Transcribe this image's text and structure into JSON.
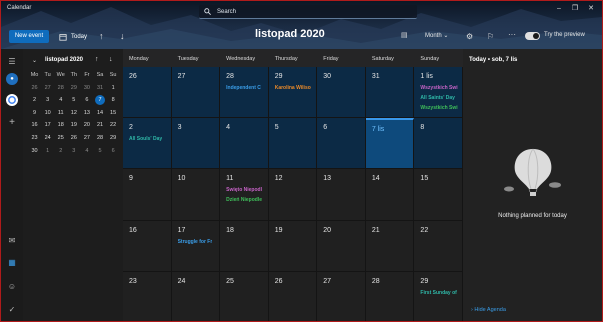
{
  "app": {
    "title": "Calendar"
  },
  "search": {
    "placeholder": "Search"
  },
  "toolbar": {
    "new_event": "New event",
    "today": "Today",
    "month_title": "listopad 2020",
    "view": "Month",
    "try_preview": "Try the preview",
    "icons": [
      "calendar-icon",
      "arrow-up-icon",
      "arrow-down-icon",
      "chevron-down-icon",
      "settings-icon",
      "feedback-icon",
      "more-icon"
    ]
  },
  "rail": {
    "icons": [
      "menu-icon",
      "outlook-account-icon",
      "google-account-icon",
      "add-icon",
      "mail-icon",
      "calendar-icon",
      "people-icon",
      "todo-icon"
    ]
  },
  "mini_calendar": {
    "title": "listopad 2020",
    "weekdays": [
      "Mo",
      "Tu",
      "We",
      "Th",
      "Fr",
      "Sa",
      "Su"
    ],
    "weeks": [
      [
        "26",
        "27",
        "28",
        "29",
        "30",
        "31",
        "1"
      ],
      [
        "2",
        "3",
        "4",
        "5",
        "6",
        "7",
        "8"
      ],
      [
        "9",
        "10",
        "11",
        "12",
        "13",
        "14",
        "15"
      ],
      [
        "16",
        "17",
        "18",
        "19",
        "20",
        "21",
        "22"
      ],
      [
        "23",
        "24",
        "25",
        "26",
        "27",
        "28",
        "29"
      ],
      [
        "30",
        "1",
        "2",
        "3",
        "4",
        "5",
        "6"
      ]
    ],
    "selected": "7"
  },
  "month_grid": {
    "weekdays": [
      "Monday",
      "Tuesday",
      "Wednesday",
      "Thursday",
      "Friday",
      "Saturday",
      "Sunday"
    ],
    "weeks": [
      [
        {
          "day": "26",
          "events": []
        },
        {
          "day": "27",
          "events": []
        },
        {
          "day": "28",
          "events": [
            {
              "text": "Independent C",
              "color": "#3a9de8"
            }
          ]
        },
        {
          "day": "29",
          "events": [
            {
              "text": "Karolina Wiliso",
              "color": "#e8892a"
            }
          ]
        },
        {
          "day": "30",
          "events": []
        },
        {
          "day": "31",
          "events": []
        },
        {
          "day": "1 lis",
          "events": [
            {
              "text": "Wszystkich Świ",
              "color": "#c763c7"
            },
            {
              "text": "All Saints' Day",
              "color": "#2fb8a8"
            },
            {
              "text": "Wszystkich Świ",
              "color": "#3fbf5a"
            }
          ]
        }
      ],
      [
        {
          "day": "2",
          "events": [
            {
              "text": "All Souls' Day",
              "color": "#2fb8a8"
            }
          ]
        },
        {
          "day": "3",
          "events": []
        },
        {
          "day": "4",
          "events": []
        },
        {
          "day": "5",
          "events": []
        },
        {
          "day": "6",
          "events": []
        },
        {
          "day": "7 lis",
          "events": []
        },
        {
          "day": "8",
          "events": []
        }
      ],
      [
        {
          "day": "9",
          "events": []
        },
        {
          "day": "10",
          "events": []
        },
        {
          "day": "11",
          "events": [
            {
              "text": "Święto Niepodl",
              "color": "#c763c7"
            },
            {
              "text": "Dzień Niepodle",
              "color": "#3fbf5a"
            }
          ]
        },
        {
          "day": "12",
          "events": []
        },
        {
          "day": "13",
          "events": []
        },
        {
          "day": "14",
          "events": []
        },
        {
          "day": "15",
          "events": []
        }
      ],
      [
        {
          "day": "16",
          "events": []
        },
        {
          "day": "17",
          "events": [
            {
              "text": "Struggle for Fr",
              "color": "#3a9de8"
            }
          ]
        },
        {
          "day": "18",
          "events": []
        },
        {
          "day": "19",
          "events": []
        },
        {
          "day": "20",
          "events": []
        },
        {
          "day": "21",
          "events": []
        },
        {
          "day": "22",
          "events": []
        }
      ],
      [
        {
          "day": "23",
          "events": []
        },
        {
          "day": "24",
          "events": []
        },
        {
          "day": "25",
          "events": []
        },
        {
          "day": "26",
          "events": []
        },
        {
          "day": "27",
          "events": []
        },
        {
          "day": "28",
          "events": []
        },
        {
          "day": "29",
          "events": [
            {
              "text": "First Sunday of",
              "color": "#2fb8a8"
            }
          ]
        }
      ]
    ],
    "today_label": "7 lis"
  },
  "agenda": {
    "header": "Today • sob, 7 lis",
    "empty_message": "Nothing planned for today",
    "hide_link": "Hide Agenda"
  },
  "colors": {
    "accent": "#0f6cbd",
    "today_cell": "#0e4a7c",
    "current_month_row": "#0c2a45"
  }
}
